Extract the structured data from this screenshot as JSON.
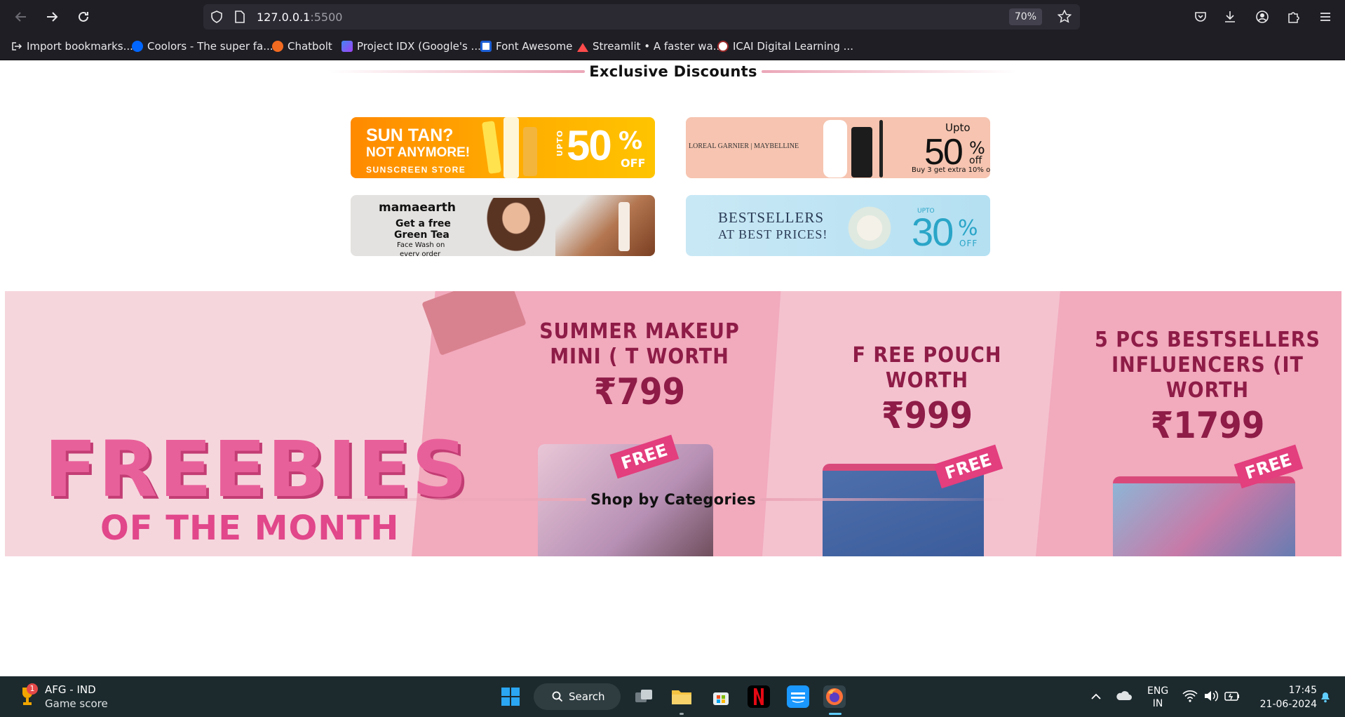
{
  "browser": {
    "url_host": "127.0.0.1",
    "url_port": ":5500",
    "zoom": "70%",
    "bookmarks": [
      {
        "label": "Import bookmarks..."
      },
      {
        "label": "Coolors - The super fa..."
      },
      {
        "label": "Chatbolt"
      },
      {
        "label": "Project IDX (Google's ..."
      },
      {
        "label": "Font Awesome"
      },
      {
        "label": "Streamlit • A faster wa..."
      },
      {
        "label": "ICAI Digital Learning ..."
      }
    ]
  },
  "page": {
    "exclusive_title": "Exclusive Discounts",
    "promos": {
      "sun": {
        "line1": "SUN TAN?",
        "line2": "NOT ANYMORE!",
        "line3": "SUNSCREEN STORE",
        "upto": "UPTO",
        "pct": "50",
        "pct_sign": "%",
        "off": "OFF"
      },
      "loreal": {
        "brands": "LOREAL  GARNIER | MAYBELLINE",
        "upto": "Upto",
        "pct": "50",
        "pct_sign": "%",
        "off": "off",
        "note": "Buy 3  get extra 10% o"
      },
      "mamaearth": {
        "brand": "mamaearth",
        "l1": "Get a free",
        "l2": "Green Tea",
        "l3": "Face Wash on",
        "l4": "every order"
      },
      "bestsellers": {
        "l1": "BESTSELLERS",
        "l2": "AT BEST PRICES!",
        "upto": "UPTO",
        "pct": "30",
        "pct_sign": "%",
        "off": "OFF"
      }
    },
    "freebies": {
      "title1": "FREEBIES",
      "title2": "OF THE MONTH",
      "offers": [
        {
          "l1": "SUMMER MAKEUP",
          "l2": "MINI ( T WORTH",
          "price": "₹799",
          "tag": "FREE"
        },
        {
          "l1": "F REE POUCH WORTH",
          "l2": "",
          "price": "₹999",
          "tag": "FREE"
        },
        {
          "l1": "5 PCS BESTSELLERS",
          "l2": "INFLUENCERS (IT WORTH",
          "price": "₹1799",
          "tag": "FREE"
        }
      ]
    },
    "categories_title": "Shop by Categories"
  },
  "taskbar": {
    "weather_badge": "1",
    "weather_l1": "AFG - IND",
    "weather_l2": "Game score",
    "search_label": "Search",
    "lang1": "ENG",
    "lang2": "IN",
    "time": "17:45",
    "date": "21-06-2024"
  }
}
